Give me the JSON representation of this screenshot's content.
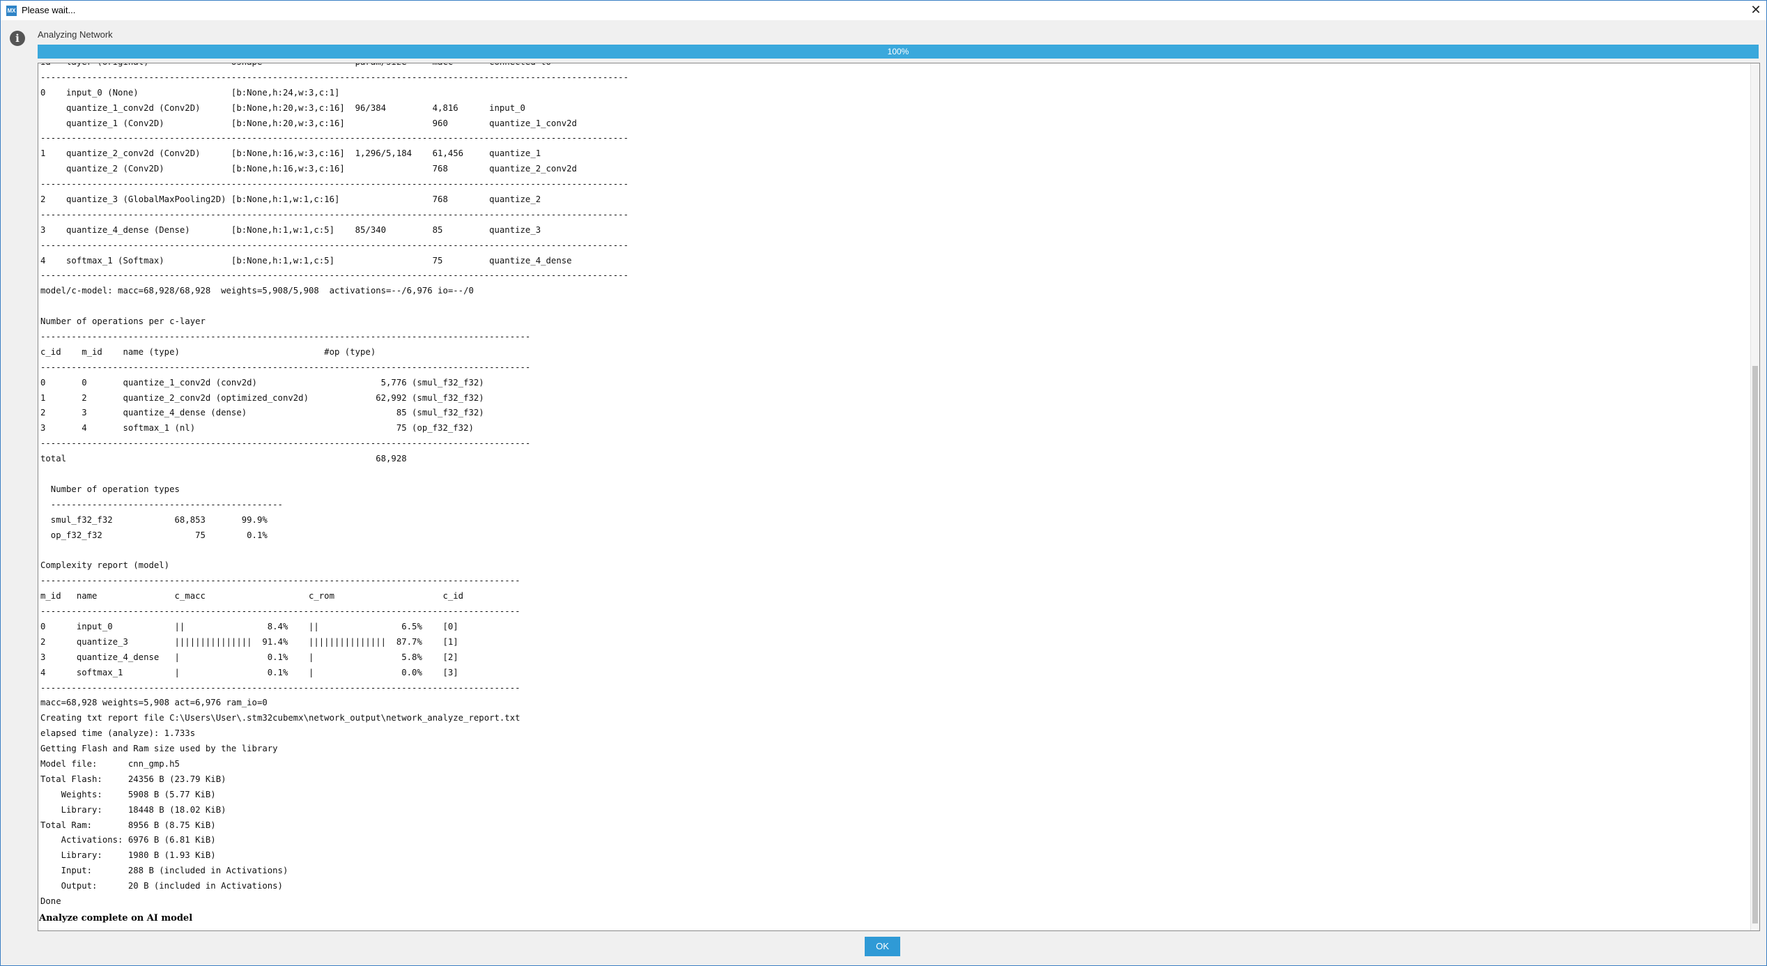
{
  "window": {
    "title": "Please wait...",
    "app_icon_text": "MX",
    "close_symbol": "✕",
    "accent": "#3aa8dc",
    "border": "#3b7fc4"
  },
  "status": {
    "icon": "info-icon",
    "icon_glyph": "i",
    "label": "Analyzing Network"
  },
  "progress": {
    "value": 1.0,
    "text": "100%",
    "color": "#3aa8dc"
  },
  "log": {
    "lines": [
      "id   layer (original)                oshape                  param/size     macc       connected to",
      "------------------------------------------------------------------------------------------------------------------",
      "0    input_0 (None)                  [b:None,h:24,w:3,c:1]",
      "     quantize_1_conv2d (Conv2D)      [b:None,h:20,w:3,c:16]  96/384         4,816      input_0",
      "     quantize_1 (Conv2D)             [b:None,h:20,w:3,c:16]                 960        quantize_1_conv2d",
      "------------------------------------------------------------------------------------------------------------------",
      "1    quantize_2_conv2d (Conv2D)      [b:None,h:16,w:3,c:16]  1,296/5,184    61,456     quantize_1",
      "     quantize_2 (Conv2D)             [b:None,h:16,w:3,c:16]                 768        quantize_2_conv2d",
      "------------------------------------------------------------------------------------------------------------------",
      "2    quantize_3 (GlobalMaxPooling2D) [b:None,h:1,w:1,c:16]                  768        quantize_2",
      "------------------------------------------------------------------------------------------------------------------",
      "3    quantize_4_dense (Dense)        [b:None,h:1,w:1,c:5]    85/340         85         quantize_3",
      "------------------------------------------------------------------------------------------------------------------",
      "4    softmax_1 (Softmax)             [b:None,h:1,w:1,c:5]                   75         quantize_4_dense",
      "------------------------------------------------------------------------------------------------------------------",
      "model/c-model: macc=68,928/68,928  weights=5,908/5,908  activations=--/6,976 io=--/0",
      "",
      "Number of operations per c-layer",
      "-----------------------------------------------------------------------------------------------",
      "c_id    m_id    name (type)                            #op (type)",
      "-----------------------------------------------------------------------------------------------",
      "0       0       quantize_1_conv2d (conv2d)                        5,776 (smul_f32_f32)",
      "1       2       quantize_2_conv2d (optimized_conv2d)             62,992 (smul_f32_f32)",
      "2       3       quantize_4_dense (dense)                             85 (smul_f32_f32)",
      "3       4       softmax_1 (nl)                                       75 (op_f32_f32)",
      "-----------------------------------------------------------------------------------------------",
      "total                                                            68,928",
      "",
      "  Number of operation types",
      "  ---------------------------------------------",
      "  smul_f32_f32            68,853       99.9%",
      "  op_f32_f32                  75        0.1%",
      "",
      "Complexity report (model)",
      "---------------------------------------------------------------------------------------------",
      "m_id   name               c_macc                    c_rom                     c_id",
      "---------------------------------------------------------------------------------------------",
      "0      input_0            ||                8.4%    ||                6.5%    [0]",
      "2      quantize_3         |||||||||||||||  91.4%    |||||||||||||||  87.7%    [1]",
      "3      quantize_4_dense   |                 0.1%    |                 5.8%    [2]",
      "4      softmax_1          |                 0.1%    |                 0.0%    [3]",
      "---------------------------------------------------------------------------------------------",
      "macc=68,928 weights=5,908 act=6,976 ram_io=0",
      "Creating txt report file C:\\Users\\User\\.stm32cubemx\\network_output\\network_analyze_report.txt",
      "elapsed time (analyze): 1.733s",
      "Getting Flash and Ram size used by the library",
      "Model file:      cnn_gmp.h5",
      "Total Flash:     24356 B (23.79 KiB)",
      "    Weights:     5908 B (5.77 KiB)",
      "    Library:     18448 B (18.02 KiB)",
      "Total Ram:       8956 B (8.75 KiB)",
      "    Activations: 6976 B (6.81 KiB)",
      "    Library:     1980 B (1.93 KiB)",
      "    Input:       288 B (included in Activations)",
      "    Output:      20 B (included in Activations)",
      "Done"
    ],
    "final_message": "Analyze complete on AI model"
  },
  "buttons": {
    "ok_label": "OK"
  }
}
